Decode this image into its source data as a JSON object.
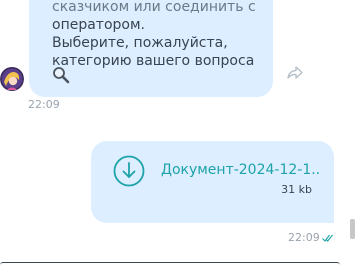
{
  "incoming": {
    "lines": [
      "сказчиком или соединить с",
      "оператором.",
      "Выберите, пожалуйста,",
      "категорию вашего вопроса"
    ],
    "emoji_icon": "magnifying-glass-icon",
    "time": "22:09"
  },
  "outgoing": {
    "file_name": "Документ-2024-12-1...",
    "file_size": "31 kb",
    "time": "22:09",
    "status_icon": "double-check-icon"
  },
  "colors": {
    "bubble": "#dceeff",
    "accent": "#1da3a8",
    "text": "#3a4450",
    "muted": "#9aa3ad"
  }
}
